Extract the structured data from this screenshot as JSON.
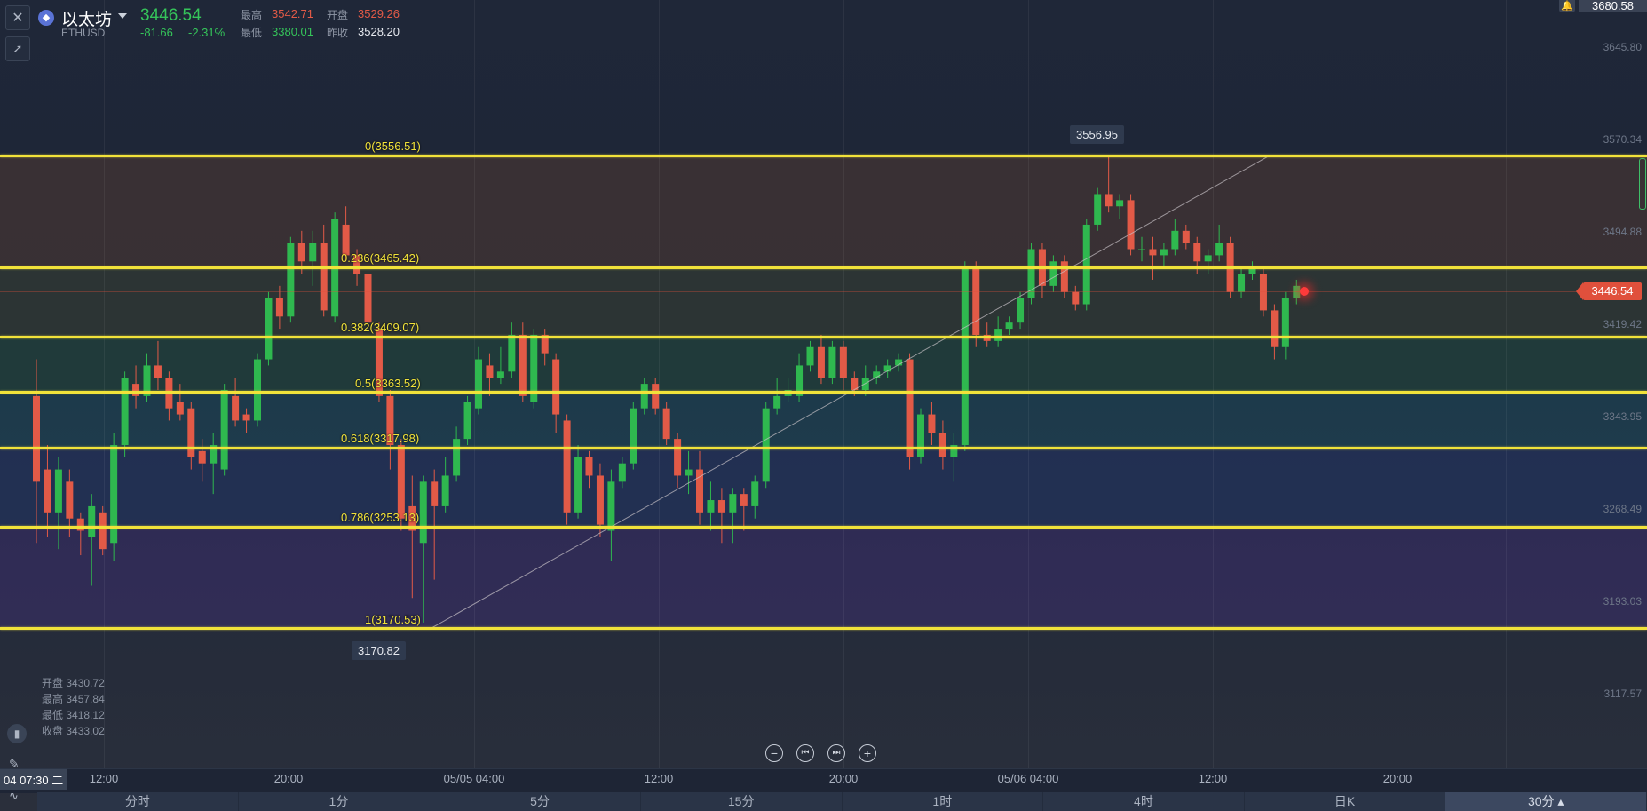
{
  "symbol": {
    "name": "以太坊",
    "code": "ETHUSD",
    "price": "3446.54",
    "change": "-81.66",
    "change_pct": "-2.31%",
    "high_label": "最高",
    "high_value": "3542.71",
    "open_label": "开盘",
    "open_value": "3529.26",
    "low_label": "最低",
    "low_value": "3380.01",
    "prev_close_label": "昨收",
    "prev_close_value": "3528.20"
  },
  "top_right_price": "3680.58",
  "current_price_badge": "3446.54",
  "price_axis": [
    "3645.80",
    "3570.34",
    "3494.88",
    "3419.42",
    "3343.95",
    "3268.49",
    "3193.03",
    "3117.57"
  ],
  "time_axis": [
    "12:00",
    "20:00",
    "05/05 04:00",
    "12:00",
    "20:00",
    "05/06 04:00",
    "12:00",
    "20:00"
  ],
  "crosshair_time": "04 07:30 二",
  "fib_levels": [
    {
      "label": "0(3556.51)",
      "price": 3556.51
    },
    {
      "label": "0.236(3465.42)",
      "price": 3465.42
    },
    {
      "label": "0.382(3409.07)",
      "price": 3409.07
    },
    {
      "label": "0.5(3363.52)",
      "price": 3363.52
    },
    {
      "label": "0.618(3317.98)",
      "price": 3317.98
    },
    {
      "label": "0.786(3253.13)",
      "price": 3253.13
    },
    {
      "label": "1(3170.53)",
      "price": 3170.53
    }
  ],
  "callouts": {
    "high": "3556.95",
    "low": "3170.82"
  },
  "ohlc_panel": [
    {
      "label": "开盘",
      "value": "3430.72"
    },
    {
      "label": "最高",
      "value": "3457.84"
    },
    {
      "label": "最低",
      "value": "3418.12"
    },
    {
      "label": "收盘",
      "value": "3433.02"
    }
  ],
  "zoom_controls": [
    "−",
    "⏮",
    "⏭",
    "+"
  ],
  "timeframe_tabs": [
    "分时",
    "1分",
    "5分",
    "15分",
    "1时",
    "4时",
    "日K",
    "30分"
  ],
  "active_timeframe": "30分",
  "colors": {
    "up": "#2fb84f",
    "down": "#e25a47",
    "fib": "#f1e23a",
    "price_badge": "#e0503c"
  },
  "chart_data": {
    "type": "candlestick",
    "symbol": "ETHUSD",
    "interval": "30分",
    "ylim": [
      3100,
      3680
    ],
    "candles": [
      {
        "o": 3360,
        "c": 3290,
        "h": 3390,
        "l": 3240
      },
      {
        "o": 3300,
        "c": 3265,
        "h": 3320,
        "l": 3245
      },
      {
        "o": 3265,
        "c": 3300,
        "h": 3310,
        "l": 3235
      },
      {
        "o": 3290,
        "c": 3260,
        "h": 3300,
        "l": 3245
      },
      {
        "o": 3260,
        "c": 3250,
        "h": 3265,
        "l": 3230
      },
      {
        "o": 3245,
        "c": 3270,
        "h": 3280,
        "l": 3205
      },
      {
        "o": 3265,
        "c": 3235,
        "h": 3270,
        "l": 3230
      },
      {
        "o": 3240,
        "c": 3320,
        "h": 3330,
        "l": 3225
      },
      {
        "o": 3320,
        "c": 3375,
        "h": 3380,
        "l": 3310
      },
      {
        "o": 3370,
        "c": 3360,
        "h": 3385,
        "l": 3350
      },
      {
        "o": 3360,
        "c": 3385,
        "h": 3395,
        "l": 3355
      },
      {
        "o": 3385,
        "c": 3375,
        "h": 3405,
        "l": 3365
      },
      {
        "o": 3375,
        "c": 3350,
        "h": 3380,
        "l": 3340
      },
      {
        "o": 3355,
        "c": 3345,
        "h": 3370,
        "l": 3340
      },
      {
        "o": 3350,
        "c": 3310,
        "h": 3355,
        "l": 3300
      },
      {
        "o": 3315,
        "c": 3305,
        "h": 3325,
        "l": 3290
      },
      {
        "o": 3305,
        "c": 3320,
        "h": 3330,
        "l": 3280
      },
      {
        "o": 3300,
        "c": 3365,
        "h": 3370,
        "l": 3295
      },
      {
        "o": 3360,
        "c": 3340,
        "h": 3375,
        "l": 3335
      },
      {
        "o": 3345,
        "c": 3340,
        "h": 3350,
        "l": 3330
      },
      {
        "o": 3340,
        "c": 3390,
        "h": 3395,
        "l": 3335
      },
      {
        "o": 3390,
        "c": 3440,
        "h": 3445,
        "l": 3385
      },
      {
        "o": 3440,
        "c": 3425,
        "h": 3450,
        "l": 3415
      },
      {
        "o": 3425,
        "c": 3485,
        "h": 3490,
        "l": 3420
      },
      {
        "o": 3485,
        "c": 3470,
        "h": 3495,
        "l": 3460
      },
      {
        "o": 3470,
        "c": 3485,
        "h": 3495,
        "l": 3450
      },
      {
        "o": 3485,
        "c": 3430,
        "h": 3500,
        "l": 3425
      },
      {
        "o": 3425,
        "c": 3505,
        "h": 3510,
        "l": 3420
      },
      {
        "o": 3500,
        "c": 3475,
        "h": 3515,
        "l": 3470
      },
      {
        "o": 3475,
        "c": 3460,
        "h": 3480,
        "l": 3450
      },
      {
        "o": 3460,
        "c": 3420,
        "h": 3465,
        "l": 3410
      },
      {
        "o": 3415,
        "c": 3360,
        "h": 3420,
        "l": 3355
      },
      {
        "o": 3360,
        "c": 3320,
        "h": 3365,
        "l": 3300
      },
      {
        "o": 3320,
        "c": 3260,
        "h": 3325,
        "l": 3250
      },
      {
        "o": 3270,
        "c": 3250,
        "h": 3295,
        "l": 3195
      },
      {
        "o": 3240,
        "c": 3290,
        "h": 3295,
        "l": 3175
      },
      {
        "o": 3290,
        "c": 3270,
        "h": 3300,
        "l": 3210
      },
      {
        "o": 3270,
        "c": 3295,
        "h": 3310,
        "l": 3265
      },
      {
        "o": 3295,
        "c": 3325,
        "h": 3335,
        "l": 3290
      },
      {
        "o": 3325,
        "c": 3355,
        "h": 3360,
        "l": 3320
      },
      {
        "o": 3350,
        "c": 3390,
        "h": 3400,
        "l": 3345
      },
      {
        "o": 3385,
        "c": 3375,
        "h": 3395,
        "l": 3360
      },
      {
        "o": 3375,
        "c": 3380,
        "h": 3400,
        "l": 3370
      },
      {
        "o": 3380,
        "c": 3410,
        "h": 3420,
        "l": 3375
      },
      {
        "o": 3410,
        "c": 3360,
        "h": 3420,
        "l": 3355
      },
      {
        "o": 3355,
        "c": 3410,
        "h": 3415,
        "l": 3350
      },
      {
        "o": 3410,
        "c": 3395,
        "h": 3415,
        "l": 3385
      },
      {
        "o": 3390,
        "c": 3345,
        "h": 3395,
        "l": 3330
      },
      {
        "o": 3340,
        "c": 3265,
        "h": 3345,
        "l": 3255
      },
      {
        "o": 3265,
        "c": 3310,
        "h": 3320,
        "l": 3260
      },
      {
        "o": 3310,
        "c": 3295,
        "h": 3315,
        "l": 3285
      },
      {
        "o": 3295,
        "c": 3255,
        "h": 3305,
        "l": 3245
      },
      {
        "o": 3250,
        "c": 3290,
        "h": 3300,
        "l": 3225
      },
      {
        "o": 3290,
        "c": 3305,
        "h": 3310,
        "l": 3285
      },
      {
        "o": 3305,
        "c": 3350,
        "h": 3355,
        "l": 3300
      },
      {
        "o": 3350,
        "c": 3370,
        "h": 3375,
        "l": 3345
      },
      {
        "o": 3370,
        "c": 3350,
        "h": 3375,
        "l": 3345
      },
      {
        "o": 3350,
        "c": 3325,
        "h": 3355,
        "l": 3320
      },
      {
        "o": 3325,
        "c": 3295,
        "h": 3330,
        "l": 3285
      },
      {
        "o": 3295,
        "c": 3300,
        "h": 3315,
        "l": 3280
      },
      {
        "o": 3300,
        "c": 3265,
        "h": 3315,
        "l": 3255
      },
      {
        "o": 3265,
        "c": 3275,
        "h": 3290,
        "l": 3250
      },
      {
        "o": 3275,
        "c": 3265,
        "h": 3285,
        "l": 3240
      },
      {
        "o": 3265,
        "c": 3280,
        "h": 3285,
        "l": 3240
      },
      {
        "o": 3280,
        "c": 3270,
        "h": 3285,
        "l": 3250
      },
      {
        "o": 3270,
        "c": 3290,
        "h": 3295,
        "l": 3260
      },
      {
        "o": 3290,
        "c": 3350,
        "h": 3355,
        "l": 3285
      },
      {
        "o": 3350,
        "c": 3360,
        "h": 3375,
        "l": 3345
      },
      {
        "o": 3360,
        "c": 3365,
        "h": 3375,
        "l": 3355
      },
      {
        "o": 3360,
        "c": 3385,
        "h": 3395,
        "l": 3355
      },
      {
        "o": 3385,
        "c": 3400,
        "h": 3405,
        "l": 3380
      },
      {
        "o": 3400,
        "c": 3375,
        "h": 3410,
        "l": 3370
      },
      {
        "o": 3375,
        "c": 3400,
        "h": 3405,
        "l": 3370
      },
      {
        "o": 3400,
        "c": 3375,
        "h": 3405,
        "l": 3365
      },
      {
        "o": 3375,
        "c": 3365,
        "h": 3380,
        "l": 3360
      },
      {
        "o": 3365,
        "c": 3375,
        "h": 3385,
        "l": 3360
      },
      {
        "o": 3375,
        "c": 3380,
        "h": 3385,
        "l": 3370
      },
      {
        "o": 3380,
        "c": 3385,
        "h": 3390,
        "l": 3375
      },
      {
        "o": 3385,
        "c": 3390,
        "h": 3395,
        "l": 3380
      },
      {
        "o": 3390,
        "c": 3310,
        "h": 3395,
        "l": 3300
      },
      {
        "o": 3310,
        "c": 3345,
        "h": 3350,
        "l": 3305
      },
      {
        "o": 3345,
        "c": 3330,
        "h": 3355,
        "l": 3320
      },
      {
        "o": 3330,
        "c": 3310,
        "h": 3340,
        "l": 3300
      },
      {
        "o": 3310,
        "c": 3320,
        "h": 3330,
        "l": 3290
      },
      {
        "o": 3320,
        "c": 3465,
        "h": 3470,
        "l": 3315
      },
      {
        "o": 3465,
        "c": 3410,
        "h": 3470,
        "l": 3400
      },
      {
        "o": 3410,
        "c": 3405,
        "h": 3420,
        "l": 3400
      },
      {
        "o": 3405,
        "c": 3415,
        "h": 3425,
        "l": 3400
      },
      {
        "o": 3415,
        "c": 3420,
        "h": 3425,
        "l": 3410
      },
      {
        "o": 3420,
        "c": 3440,
        "h": 3445,
        "l": 3415
      },
      {
        "o": 3440,
        "c": 3480,
        "h": 3485,
        "l": 3435
      },
      {
        "o": 3480,
        "c": 3450,
        "h": 3485,
        "l": 3440
      },
      {
        "o": 3450,
        "c": 3470,
        "h": 3475,
        "l": 3445
      },
      {
        "o": 3470,
        "c": 3445,
        "h": 3475,
        "l": 3440
      },
      {
        "o": 3445,
        "c": 3435,
        "h": 3450,
        "l": 3430
      },
      {
        "o": 3435,
        "c": 3500,
        "h": 3505,
        "l": 3430
      },
      {
        "o": 3500,
        "c": 3525,
        "h": 3530,
        "l": 3495
      },
      {
        "o": 3525,
        "c": 3515,
        "h": 3557,
        "l": 3510
      },
      {
        "o": 3515,
        "c": 3520,
        "h": 3525,
        "l": 3505
      },
      {
        "o": 3520,
        "c": 3480,
        "h": 3525,
        "l": 3475
      },
      {
        "o": 3480,
        "c": 3480,
        "h": 3490,
        "l": 3470
      },
      {
        "o": 3480,
        "c": 3475,
        "h": 3490,
        "l": 3455
      },
      {
        "o": 3475,
        "c": 3480,
        "h": 3485,
        "l": 3465
      },
      {
        "o": 3480,
        "c": 3495,
        "h": 3505,
        "l": 3475
      },
      {
        "o": 3495,
        "c": 3485,
        "h": 3500,
        "l": 3480
      },
      {
        "o": 3485,
        "c": 3470,
        "h": 3490,
        "l": 3460
      },
      {
        "o": 3470,
        "c": 3475,
        "h": 3480,
        "l": 3460
      },
      {
        "o": 3475,
        "c": 3485,
        "h": 3500,
        "l": 3470
      },
      {
        "o": 3485,
        "c": 3445,
        "h": 3490,
        "l": 3440
      },
      {
        "o": 3445,
        "c": 3460,
        "h": 3465,
        "l": 3440
      },
      {
        "o": 3460,
        "c": 3465,
        "h": 3470,
        "l": 3455
      },
      {
        "o": 3460,
        "c": 3430,
        "h": 3465,
        "l": 3425
      },
      {
        "o": 3430,
        "c": 3400,
        "h": 3435,
        "l": 3390
      },
      {
        "o": 3400,
        "c": 3440,
        "h": 3445,
        "l": 3390
      },
      {
        "o": 3440,
        "c": 3450,
        "h": 3455,
        "l": 3435
      }
    ]
  }
}
